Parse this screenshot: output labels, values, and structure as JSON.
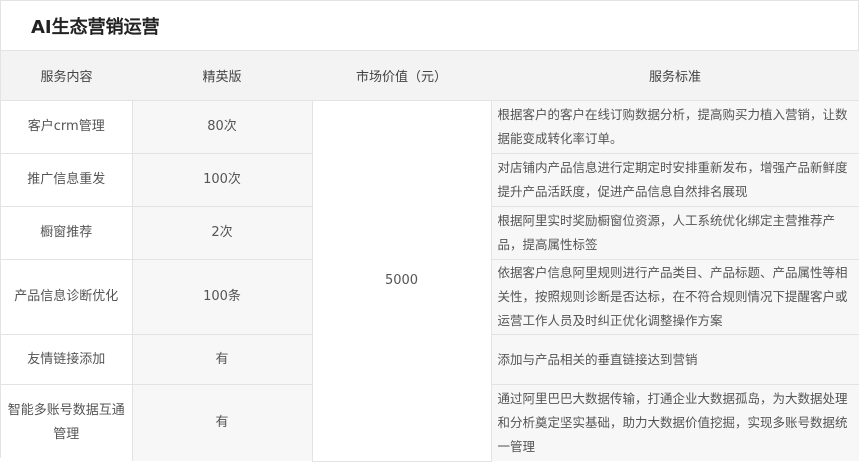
{
  "title": "AI生态营销运营",
  "table": {
    "headers": {
      "service": "服务内容",
      "plan": "精英版",
      "price": "市场价值（元）",
      "standard": "服务标准"
    },
    "price": "5000",
    "rows": [
      {
        "service": "客户crm管理",
        "plan": "80次",
        "standard": "根据客户的客户在线订购数据分析，提高购买力植入营销，让数据能变成转化率订单。"
      },
      {
        "service": "推广信息重发",
        "plan": "100次",
        "standard": "对店铺内产品信息进行定期定时安排重新发布，增强产品新鲜度提升产品活跃度，促进产品信息自然排名展现"
      },
      {
        "service": "橱窗推荐",
        "plan": "2次",
        "standard": "根据阿里实时奖励橱窗位资源，人工系统优化绑定主营推荐产品，提高属性标签"
      },
      {
        "service": "产品信息诊断优化",
        "plan": "100条",
        "standard": "依据客户信息阿里规则进行产品类目、产品标题、产品属性等相关性，按照规则诊断是否达标，在不符合规则情况下提醒客户或运营工作人员及时纠正优化调整操作方案"
      },
      {
        "service": "友情链接添加",
        "plan": "有",
        "standard": "添加与产品相关的垂直链接达到营销"
      },
      {
        "service": "智能多账号数据互通管理",
        "plan": "有",
        "standard": "通过阿里巴巴大数据传输，打通企业大数据孤岛，为大数据处理和分析奠定坚实基础，助力大数据价值挖掘，实现多账号数据统一管理"
      }
    ]
  }
}
